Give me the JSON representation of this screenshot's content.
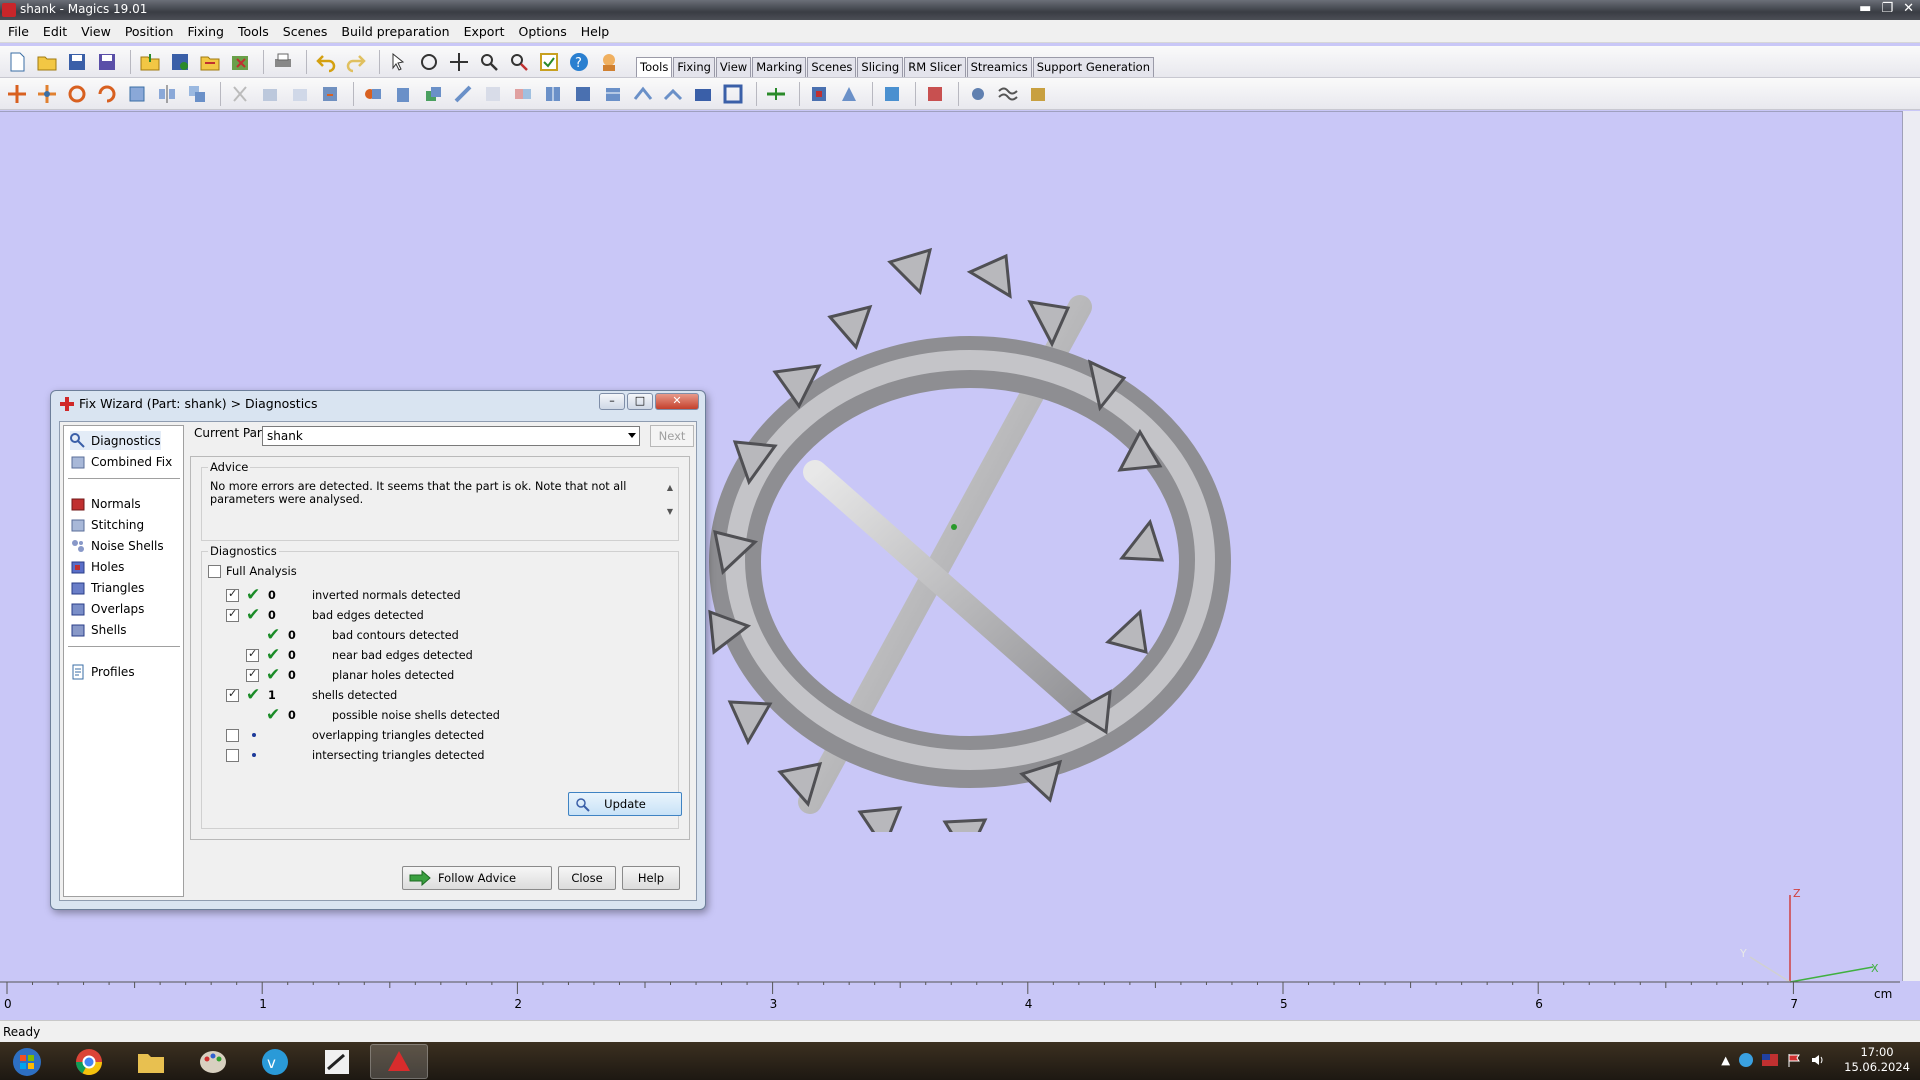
{
  "window": {
    "title": "shank - Magics 19.01",
    "min": "▬",
    "max": "❐",
    "close": "✕"
  },
  "menu": [
    "File",
    "Edit",
    "View",
    "Position",
    "Fixing",
    "Tools",
    "Scenes",
    "Build preparation",
    "Export",
    "Options",
    "Help"
  ],
  "tabs": [
    {
      "label": "Tools",
      "active": true
    },
    {
      "label": "Fixing",
      "active": false
    },
    {
      "label": "View",
      "active": false
    },
    {
      "label": "Marking",
      "active": false
    },
    {
      "label": "Scenes",
      "active": false
    },
    {
      "label": "Slicing",
      "active": false
    },
    {
      "label": "RM Slicer",
      "active": false
    },
    {
      "label": "Streamics",
      "active": false
    },
    {
      "label": "Support Generation",
      "active": false
    }
  ],
  "dialog": {
    "title": "Fix Wizard (Part: shank) > Diagnostics",
    "nav": {
      "top": [
        {
          "label": "Diagnostics",
          "icon": "stethoscope-icon"
        },
        {
          "label": "Combined Fix",
          "icon": "cube-icon"
        }
      ],
      "middle": [
        {
          "label": "Normals",
          "icon": "normals-cube-icon"
        },
        {
          "label": "Stitching",
          "icon": "stitching-cube-icon"
        },
        {
          "label": "Noise Shells",
          "icon": "noise-shells-icon"
        },
        {
          "label": "Holes",
          "icon": "holes-cube-icon"
        },
        {
          "label": "Triangles",
          "icon": "triangles-cube-icon"
        },
        {
          "label": "Overlaps",
          "icon": "overlaps-cube-icon"
        },
        {
          "label": "Shells",
          "icon": "shells-cube-icon"
        }
      ],
      "bottom": [
        {
          "label": "Profiles",
          "icon": "profiles-icon"
        }
      ]
    },
    "current_part_label": "Current Part:",
    "current_part_value": "shank",
    "next_label": "Next",
    "advice_label": "Advice",
    "advice_text": "No more errors are detected. It seems that the part is ok. Note that not all parameters were analysed.",
    "diagnostics_label": "Diagnostics",
    "full_analysis_label": "Full Analysis",
    "full_analysis_checked": false,
    "rows": [
      {
        "indent": 0,
        "checkbox": true,
        "checked": true,
        "status": "ok",
        "count": "0",
        "label": "inverted normals detected"
      },
      {
        "indent": 0,
        "checkbox": true,
        "checked": true,
        "status": "ok",
        "count": "0",
        "label": "bad edges detected"
      },
      {
        "indent": 1,
        "checkbox": false,
        "checked": false,
        "status": "ok",
        "count": "0",
        "label": "bad contours detected"
      },
      {
        "indent": 1,
        "checkbox": true,
        "checked": true,
        "status": "ok",
        "count": "0",
        "label": "near bad edges detected"
      },
      {
        "indent": 1,
        "checkbox": true,
        "checked": true,
        "status": "ok",
        "count": "0",
        "label": "planar holes detected"
      },
      {
        "indent": 0,
        "checkbox": true,
        "checked": true,
        "status": "ok",
        "count": "1",
        "label": "shells detected"
      },
      {
        "indent": 1,
        "checkbox": false,
        "checked": false,
        "status": "ok",
        "count": "0",
        "label": "possible noise shells detected"
      },
      {
        "indent": 0,
        "checkbox": true,
        "checked": false,
        "status": "pending",
        "count": "",
        "label": "overlapping triangles detected"
      },
      {
        "indent": 0,
        "checkbox": true,
        "checked": false,
        "status": "pending",
        "count": "",
        "label": "intersecting triangles detected"
      }
    ],
    "update_label": "Update",
    "follow_advice_label": "Follow Advice",
    "close_label": "Close",
    "help_label": "Help"
  },
  "ruler": {
    "ticks": [
      "0",
      "1",
      "2",
      "3",
      "4",
      "5",
      "6",
      "7"
    ],
    "unit": "cm"
  },
  "axes": {
    "z": "Z",
    "x": "X",
    "y": "Y"
  },
  "status": "Ready",
  "clock": {
    "time": "17:00",
    "date": "15.06.2024"
  },
  "colors": {
    "viewport": "#c9c7f7",
    "ok_check": "#1b8c28",
    "pending_dot": "#1d3a9a",
    "accent_red": "#c8262a"
  }
}
